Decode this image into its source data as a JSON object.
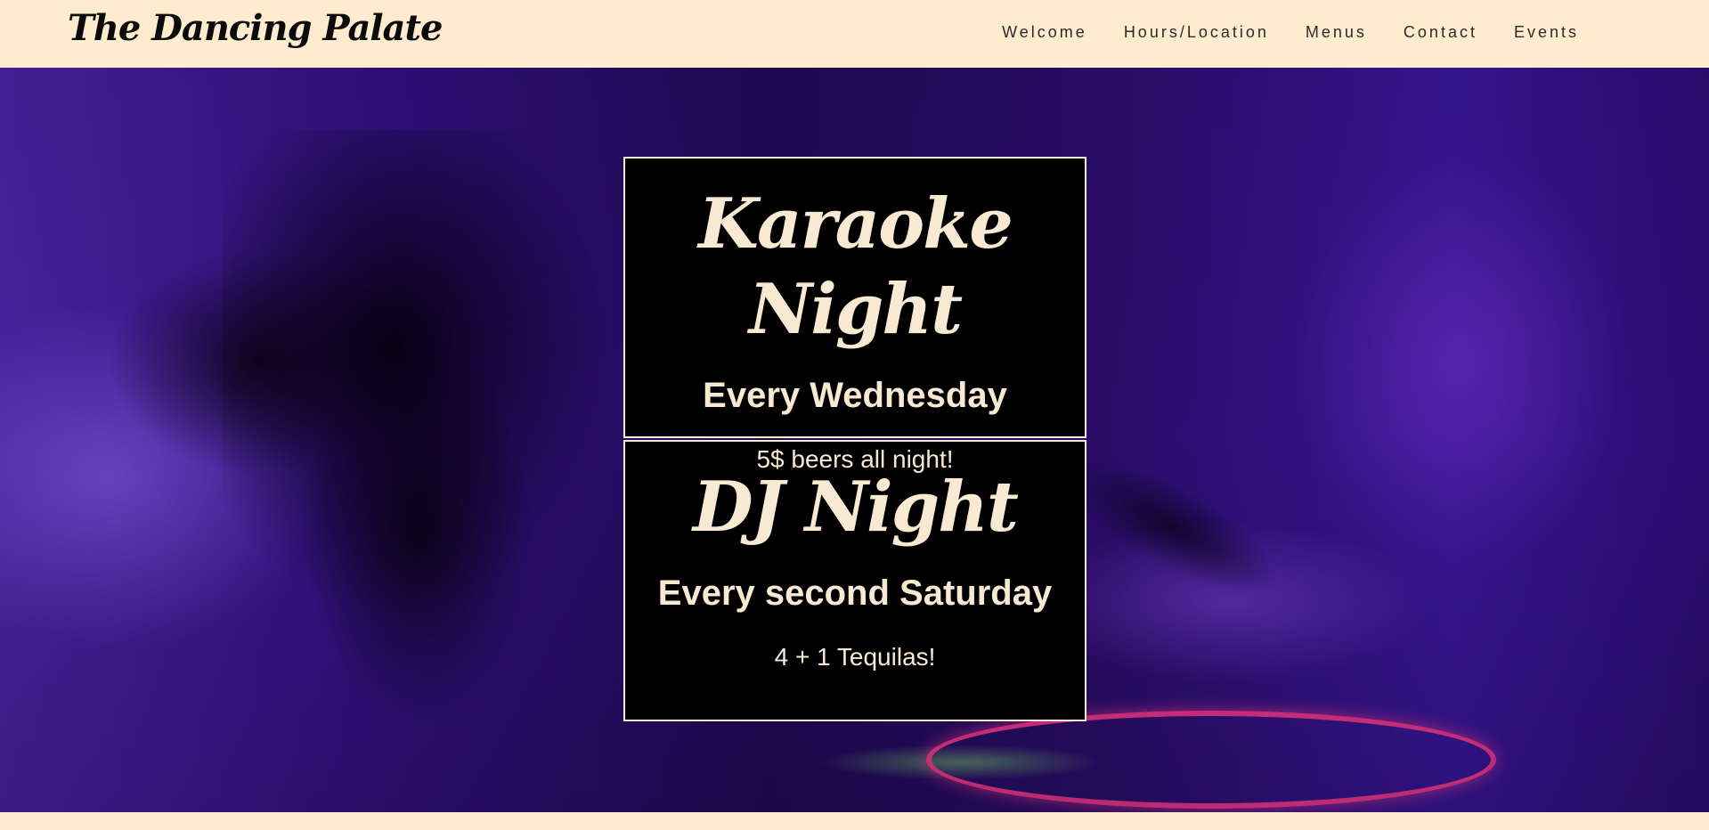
{
  "site": {
    "brand": "The Dancing Palate"
  },
  "nav": {
    "items": [
      {
        "label": "Welcome"
      },
      {
        "label": "Hours/Location"
      },
      {
        "label": "Menus"
      },
      {
        "label": "Contact"
      },
      {
        "label": "Events"
      }
    ]
  },
  "events": [
    {
      "title": "Karaoke Night",
      "schedule": "Every Wednesday",
      "deal": "5$ beers all night!"
    },
    {
      "title": "DJ Night",
      "schedule": "Every second Saturday",
      "deal": "4 + 1 Tequilas!"
    }
  ],
  "colors": {
    "background": "#ffeccf",
    "card_background": "#000000",
    "card_text": "#f7e9d2",
    "card_border": "#f6ead6",
    "nav_text": "#2a2a2a"
  }
}
